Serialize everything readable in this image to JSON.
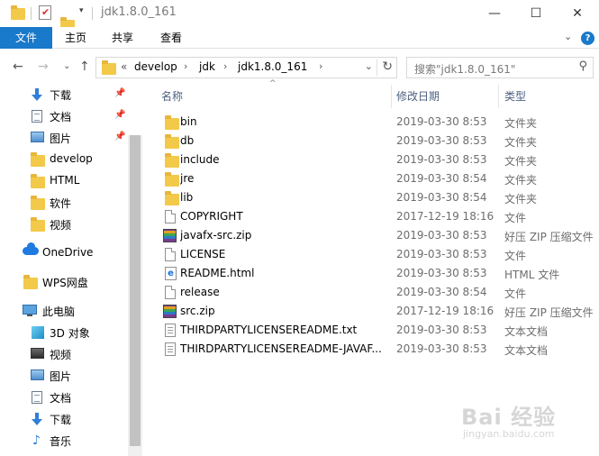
{
  "window": {
    "title": "jdk1.8.0_161",
    "minimize": "—",
    "maximize": "☐",
    "close": "✕"
  },
  "ribbon": {
    "tabs": [
      "文件",
      "主页",
      "共享",
      "查看"
    ],
    "expand": "⌄",
    "help": "?"
  },
  "nav": {
    "back": "←",
    "forward": "→",
    "recent": "⌄",
    "up": "↑",
    "crumb_overflow": "«",
    "breadcrumb": [
      "develop",
      "jdk",
      "jdk1.8.0_161"
    ],
    "crumb_sep": "›",
    "dropdown": "⌄",
    "refresh": "↻",
    "search_placeholder": "搜索\"jdk1.8.0_161\"",
    "search_icon": "⚲"
  },
  "sidebar": {
    "quick_access": [
      {
        "label": "下载",
        "icon": "download-icon",
        "pinned": true
      },
      {
        "label": "文档",
        "icon": "document-icon",
        "pinned": true
      },
      {
        "label": "图片",
        "icon": "picture-icon",
        "pinned": true
      },
      {
        "label": "develop",
        "icon": "folder-icon",
        "pinned": false
      },
      {
        "label": "HTML",
        "icon": "folder-icon",
        "pinned": false
      },
      {
        "label": "软件",
        "icon": "folder-icon",
        "pinned": false
      },
      {
        "label": "视频",
        "icon": "folder-icon",
        "pinned": false
      }
    ],
    "onedrive": "OneDrive",
    "wps": "WPS网盘",
    "this_pc": "此电脑",
    "pc_items": [
      {
        "label": "3D 对象",
        "icon": "3d-objects-icon"
      },
      {
        "label": "视频",
        "icon": "video-icon"
      },
      {
        "label": "图片",
        "icon": "picture-icon"
      },
      {
        "label": "文档",
        "icon": "document-icon"
      },
      {
        "label": "下载",
        "icon": "download-icon"
      },
      {
        "label": "音乐",
        "icon": "music-icon"
      }
    ],
    "pin_glyph": "📌"
  },
  "columns": {
    "name": "名称",
    "date": "修改日期",
    "type": "类型",
    "sort_glyph": "^"
  },
  "files": [
    {
      "name": "bin",
      "date": "2019-03-30 8:53",
      "type": "文件夹",
      "icon": "folder"
    },
    {
      "name": "db",
      "date": "2019-03-30 8:53",
      "type": "文件夹",
      "icon": "folder"
    },
    {
      "name": "include",
      "date": "2019-03-30 8:53",
      "type": "文件夹",
      "icon": "folder"
    },
    {
      "name": "jre",
      "date": "2019-03-30 8:54",
      "type": "文件夹",
      "icon": "folder"
    },
    {
      "name": "lib",
      "date": "2019-03-30 8:54",
      "type": "文件夹",
      "icon": "folder"
    },
    {
      "name": "COPYRIGHT",
      "date": "2017-12-19 18:16",
      "type": "文件",
      "icon": "file"
    },
    {
      "name": "javafx-src.zip",
      "date": "2019-03-30 8:53",
      "type": "好压 ZIP 压缩文件",
      "icon": "zip"
    },
    {
      "name": "LICENSE",
      "date": "2019-03-30 8:53",
      "type": "文件",
      "icon": "file"
    },
    {
      "name": "README.html",
      "date": "2019-03-30 8:53",
      "type": "HTML 文件",
      "icon": "html"
    },
    {
      "name": "release",
      "date": "2019-03-30 8:54",
      "type": "文件",
      "icon": "file"
    },
    {
      "name": "src.zip",
      "date": "2017-12-19 18:16",
      "type": "好压 ZIP 压缩文件",
      "icon": "zip"
    },
    {
      "name": "THIRDPARTYLICENSEREADME.txt",
      "date": "2019-03-30 8:53",
      "type": "文本文档",
      "icon": "txt"
    },
    {
      "name": "THIRDPARTYLICENSEREADME-JAVAF...",
      "date": "2019-03-30 8:53",
      "type": "文本文档",
      "icon": "txt"
    }
  ],
  "watermark": {
    "main": "Bai 经验",
    "sub": "jingyan.baidu.com"
  },
  "colors": {
    "accent": "#1979ca",
    "folder": "#f3c94a",
    "header_text": "#4d6082"
  }
}
